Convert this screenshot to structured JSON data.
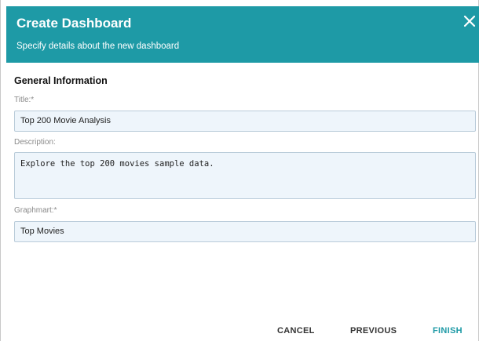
{
  "dialog": {
    "title": "Create Dashboard",
    "subtitle": "Specify details about the new dashboard",
    "close_icon": "close-icon"
  },
  "form": {
    "section_title": "General Information",
    "title_label": "Title:*",
    "title_value": "Top 200 Movie Analysis",
    "description_label": "Description:",
    "description_value": "Explore the top 200 movies sample data.",
    "graphmart_label": "Graphmart:*",
    "graphmart_value": "Top Movies"
  },
  "footer": {
    "cancel_label": "CANCEL",
    "previous_label": "PREVIOUS",
    "finish_label": "FINISH"
  },
  "colors": {
    "header_bg": "#1e9aa6",
    "accent": "#1e9aa6",
    "field_bg": "#eef5fb"
  }
}
